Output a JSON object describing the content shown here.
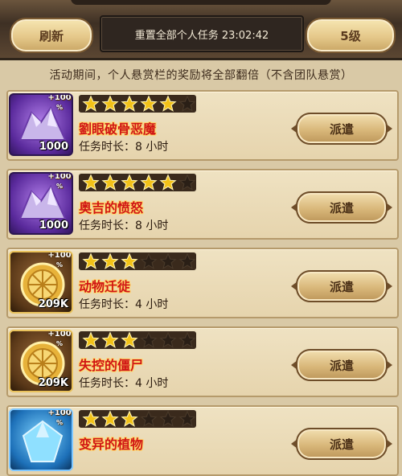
{
  "header": {
    "refresh_label": "刷新",
    "reset_text": "重置全部个人任务 23:02:42",
    "level_label": "5级"
  },
  "notice": "活动期间，个人悬赏栏的奖励将全部翻倍（不含团队悬赏）",
  "duration_prefix": "任务时长：",
  "dispatch_label": "派遣",
  "max_stars": 6,
  "quests": [
    {
      "reward_icon": "purple-crystal-icon",
      "reward_qty": "1000",
      "bonus": "+100",
      "bonus_pct": "%",
      "stars": 5,
      "name": "劉眼破骨恶魔",
      "duration": "8 小时"
    },
    {
      "reward_icon": "purple-crystal-icon",
      "reward_qty": "1000",
      "bonus": "+100",
      "bonus_pct": "%",
      "stars": 5,
      "name": "奥吉的愤怒",
      "duration": "8 小时"
    },
    {
      "reward_icon": "gold-coin-icon",
      "reward_qty": "209K",
      "bonus": "+100",
      "bonus_pct": "%",
      "stars": 3,
      "name": "动物迁徙",
      "duration": "4 小时"
    },
    {
      "reward_icon": "gold-coin-icon",
      "reward_qty": "209K",
      "bonus": "+100",
      "bonus_pct": "%",
      "stars": 3,
      "name": "失控的僵尸",
      "duration": "4 小时"
    },
    {
      "reward_icon": "blue-gem-icon",
      "reward_qty": "",
      "bonus": "+100",
      "bonus_pct": "%",
      "stars": 3,
      "name": "变异的植物",
      "duration": ""
    }
  ]
}
